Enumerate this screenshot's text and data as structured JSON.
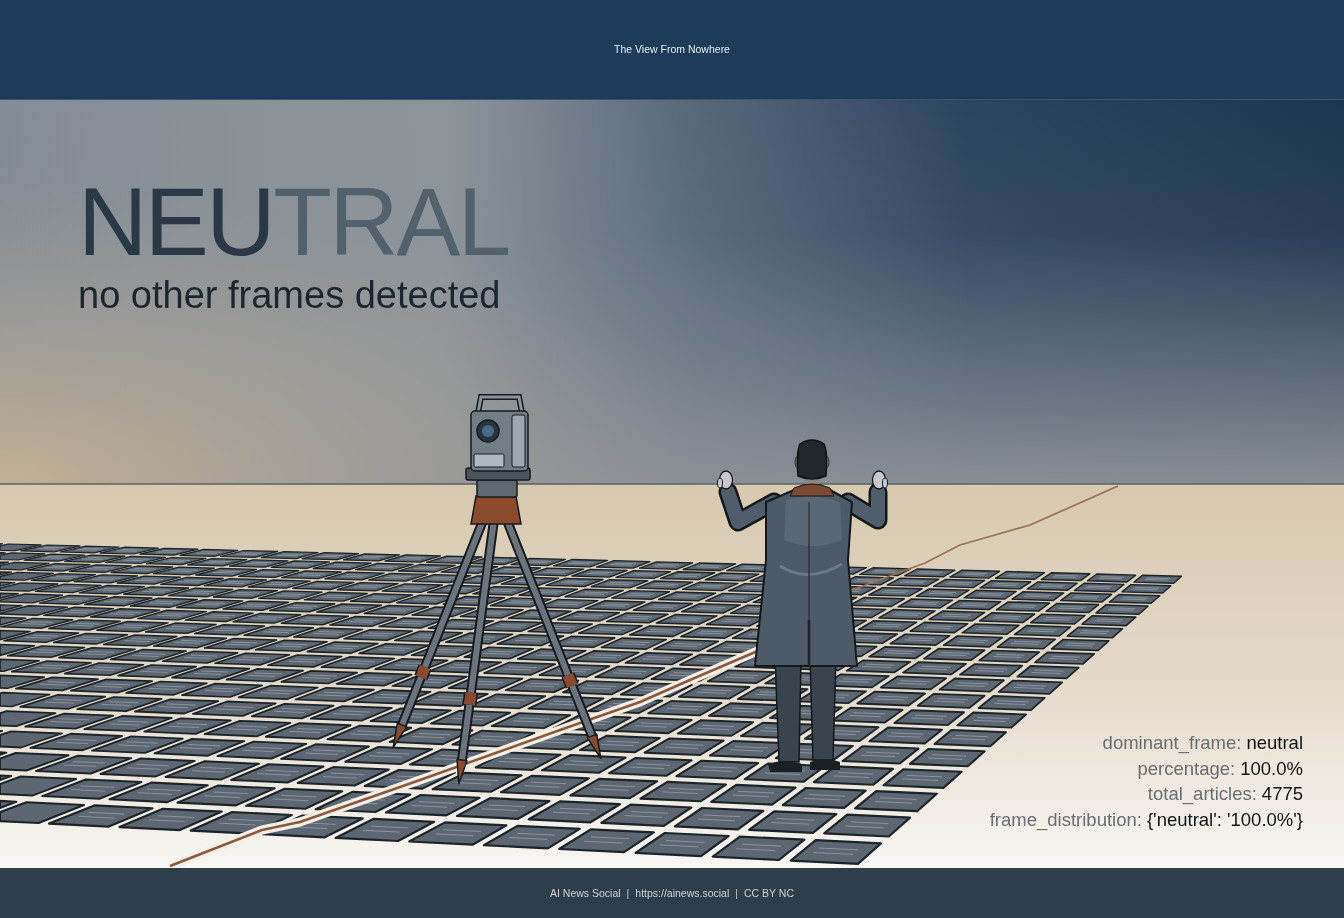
{
  "header": {
    "title": "The View From Nowhere"
  },
  "hero": {
    "headline": "**NEU**TRAL",
    "subtitle": "no other frames detected"
  },
  "stats": [
    {
      "label": "dominant_frame:",
      "value": "neutral"
    },
    {
      "label": "percentage:",
      "value": "100.0%"
    },
    {
      "label": "total_articles:",
      "value": "4775"
    },
    {
      "label": "frame_distribution:",
      "value": "{'neutral': '100.0%'}"
    }
  ],
  "footer": {
    "parts": [
      {
        "kind": "text",
        "text": "AI News Social"
      },
      {
        "kind": "separator",
        "text": "|"
      },
      {
        "kind": "text",
        "text": "https://ainews.social"
      },
      {
        "kind": "separator",
        "text": "|"
      },
      {
        "kind": "text",
        "text": "CC BY NC"
      }
    ]
  }
}
